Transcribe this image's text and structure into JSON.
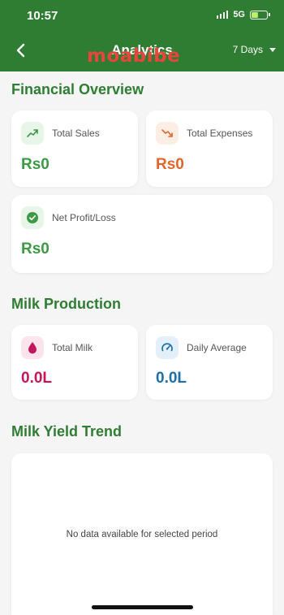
{
  "status": {
    "time": "10:57",
    "network": "5G"
  },
  "header": {
    "title": "Analytics",
    "watermark": "moabibe",
    "period_label": "7 Days",
    "icons": {
      "back": "chevron-left-icon",
      "period": "caret-down-icon"
    }
  },
  "financial": {
    "title": "Financial Overview",
    "total_sales": {
      "label": "Total Sales",
      "value": "Rs0",
      "color": "#3b9a43",
      "icon": "trending-up-icon"
    },
    "total_expenses": {
      "label": "Total Expenses",
      "value": "Rs0",
      "color": "#e0662b",
      "icon": "trending-down-icon"
    },
    "net_profit": {
      "label": "Net Profit/Loss",
      "value": "Rs0",
      "color": "#3b9a43",
      "icon": "check-circle-icon"
    }
  },
  "milk": {
    "title": "Milk Production",
    "total_milk": {
      "label": "Total Milk",
      "value": "0.0L",
      "color": "#c2185b",
      "icon": "water-drop-icon"
    },
    "daily_average": {
      "label": "Daily Average",
      "value": "0.0L",
      "color": "#1e6fa8",
      "icon": "speedometer-icon"
    }
  },
  "trend": {
    "title": "Milk Yield Trend",
    "empty_message": "No data available for selected period"
  },
  "colors": {
    "primary": "#2e7d32",
    "background": "#f5f5f5"
  }
}
